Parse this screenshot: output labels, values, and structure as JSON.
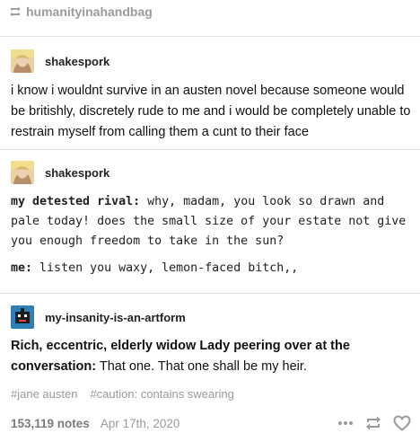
{
  "reblog": {
    "icon": "reblog-icon",
    "username": "humanityinahandbag"
  },
  "posts": [
    {
      "username": "shakespork",
      "avatar": "avatar-blonde-anime",
      "text": "i know i wouldnt survive in an austen novel because someone would be britishly, discretely rude to me and i would be completely unable to restrain myself from calling them a cunt to their face"
    },
    {
      "username": "shakespork",
      "avatar": "avatar-blonde-anime",
      "dialogue": [
        {
          "speaker": "my detested rival:",
          "line": "why, madam, you look so drawn and pale today! does the small size of your estate not give you enough freedom to take in the sun?"
        },
        {
          "speaker": "me:",
          "line": "listen you waxy, lemon-faced bitch,,"
        }
      ]
    },
    {
      "username": "my-insanity-is-an-artform",
      "avatar": "avatar-pixel-robot",
      "bold_text": "Rich, eccentric, elderly widow Lady peering over at the conversation:",
      "text": "That one. That one shall be my heir."
    }
  ],
  "tags": [
    "#jane austen",
    "#caution: contains swearing"
  ],
  "footer": {
    "notes": "153,119 notes",
    "date": "Apr 17th, 2020",
    "icons": [
      "more-icon",
      "reblog-icon",
      "heart-icon"
    ]
  },
  "colors": {
    "muted": "#9a9a9a",
    "divider": "#e3e3e3",
    "notes": "#7b7b7b"
  }
}
